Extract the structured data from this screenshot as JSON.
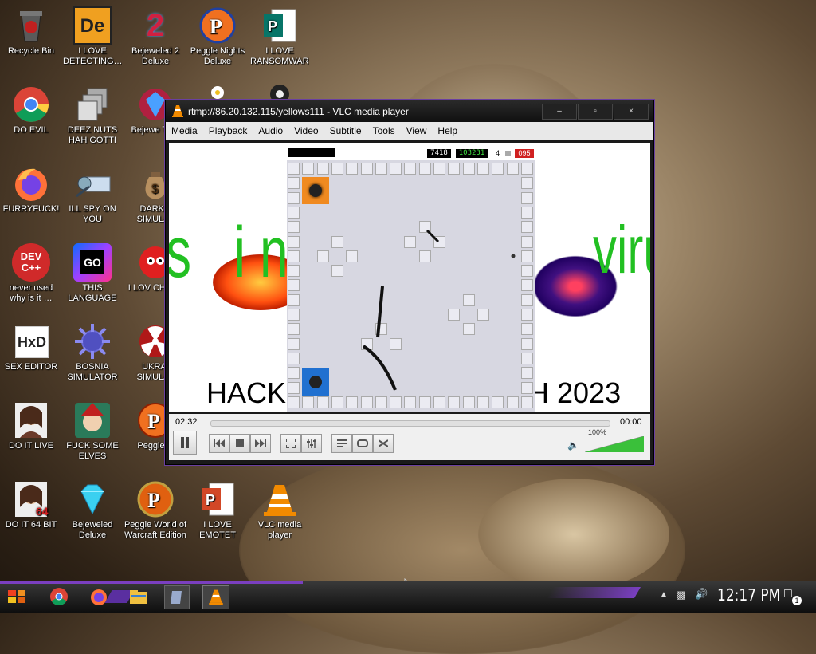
{
  "desktop": {
    "icons": [
      {
        "label": "Recycle Bin"
      },
      {
        "label": "I LOVE DETECTING…"
      },
      {
        "label": "Bejeweled 2 Deluxe"
      },
      {
        "label": "Peggle Nights Deluxe"
      },
      {
        "label": "I LOVE RANSOMWARE"
      },
      {
        "label": "DO EVIL"
      },
      {
        "label": "DEEZ NUTS HAH GOTTI"
      },
      {
        "label": "Bejewe Twis"
      },
      {
        "label": "FURRYFUCK!"
      },
      {
        "label": "ILL SPY ON YOU"
      },
      {
        "label": "DARKO SIMULAT"
      },
      {
        "label": "never used why is it …"
      },
      {
        "label": "THIS LANGUAGE …"
      },
      {
        "label": "I LOV CHUZZ"
      },
      {
        "label": "SEX EDITOR"
      },
      {
        "label": "BOSNIA SIMULATOR"
      },
      {
        "label": "UKRAI SIMULAT"
      },
      {
        "label": "DO IT LIVE"
      },
      {
        "label": "FUCK SOME ELVES"
      },
      {
        "label": "Peggle D"
      },
      {
        "label": "DO IT 64 BIT"
      },
      {
        "label": "Bejeweled Deluxe"
      },
      {
        "label": "Peggle World of Warcraft Edition"
      },
      {
        "label": "I LOVE EMOTET"
      },
      {
        "label": "VLC media player"
      }
    ],
    "icon_text": {
      "go": "GO",
      "dev": "DEV",
      "cpp": "C++",
      "hxd": "HxD",
      "num64": "64"
    }
  },
  "vlc": {
    "title": "rtmp://86.20.132.115/yellows111 - VLC media player",
    "menu": [
      "Media",
      "Playback",
      "Audio",
      "Video",
      "Subtitle",
      "Tools",
      "View",
      "Help"
    ],
    "time_elapsed": "02:32",
    "time_total": "00:00",
    "volume": "100%",
    "volume_level": 1.0,
    "winbtns": {
      "min": "–",
      "max": "▫",
      "close": "×"
    },
    "video": {
      "left_text": "s infe",
      "right_text": "viru",
      "bottom_left": "HACK",
      "bottom_right": "H 2023",
      "hud": {
        "score1": "7418",
        "score2": "103231",
        "count": "4",
        "red": "095"
      }
    }
  },
  "taskbar": {
    "clock": "12:17 PM",
    "notifications": "1"
  },
  "colors": {
    "accent": "#7a3fc0",
    "vlc_orange": "#f28a00",
    "green_text": "#22c022"
  }
}
